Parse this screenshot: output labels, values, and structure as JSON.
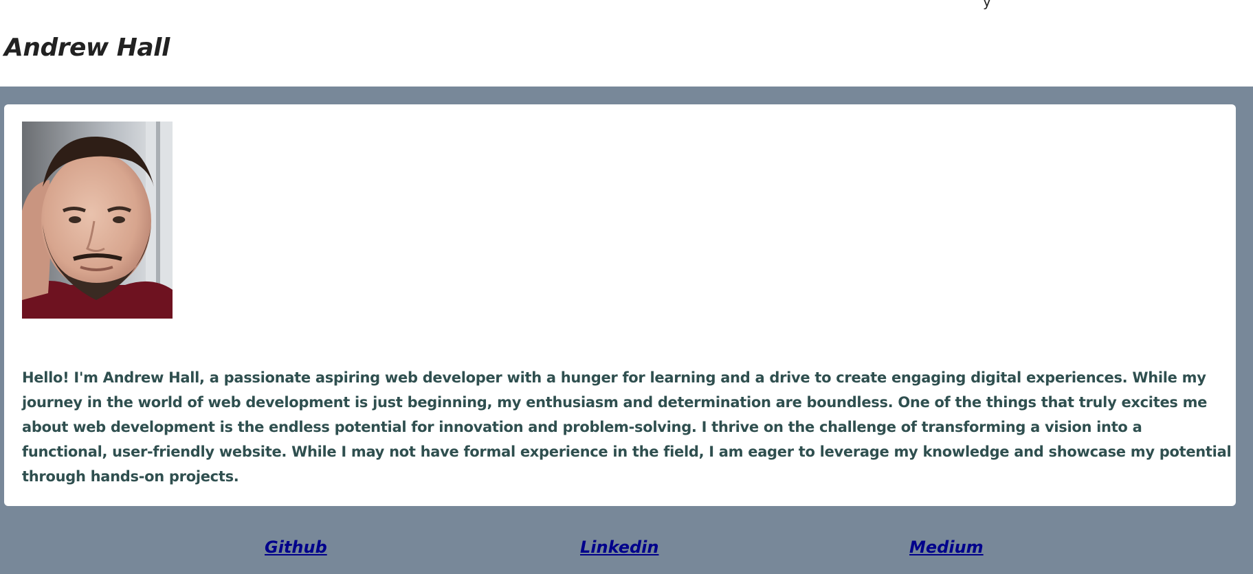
{
  "header": {
    "name": "Andrew Hall"
  },
  "about": {
    "bio": "Hello! I'm Andrew Hall, a passionate aspiring web developer with a hunger for learning and a drive to create engaging digital experiences. While my journey in the world of web development is just beginning, my enthusiasm and determination are boundless. One of the things that truly excites me about web development is the endless potential for innovation and problem-solving. I thrive on the challenge of transforming a vision into a functional, user-friendly website. While I may not have formal experience in the field, I am eager to leverage my knowledge and showcase my potential through hands-on projects."
  },
  "links": {
    "github": "Github",
    "linkedin": "Linkedin",
    "medium": "Medium"
  },
  "colors": {
    "page_background": "#788899",
    "card_background": "#ffffff",
    "text_primary": "#2f4f4f",
    "link": "#00008b",
    "heading": "#222222"
  }
}
